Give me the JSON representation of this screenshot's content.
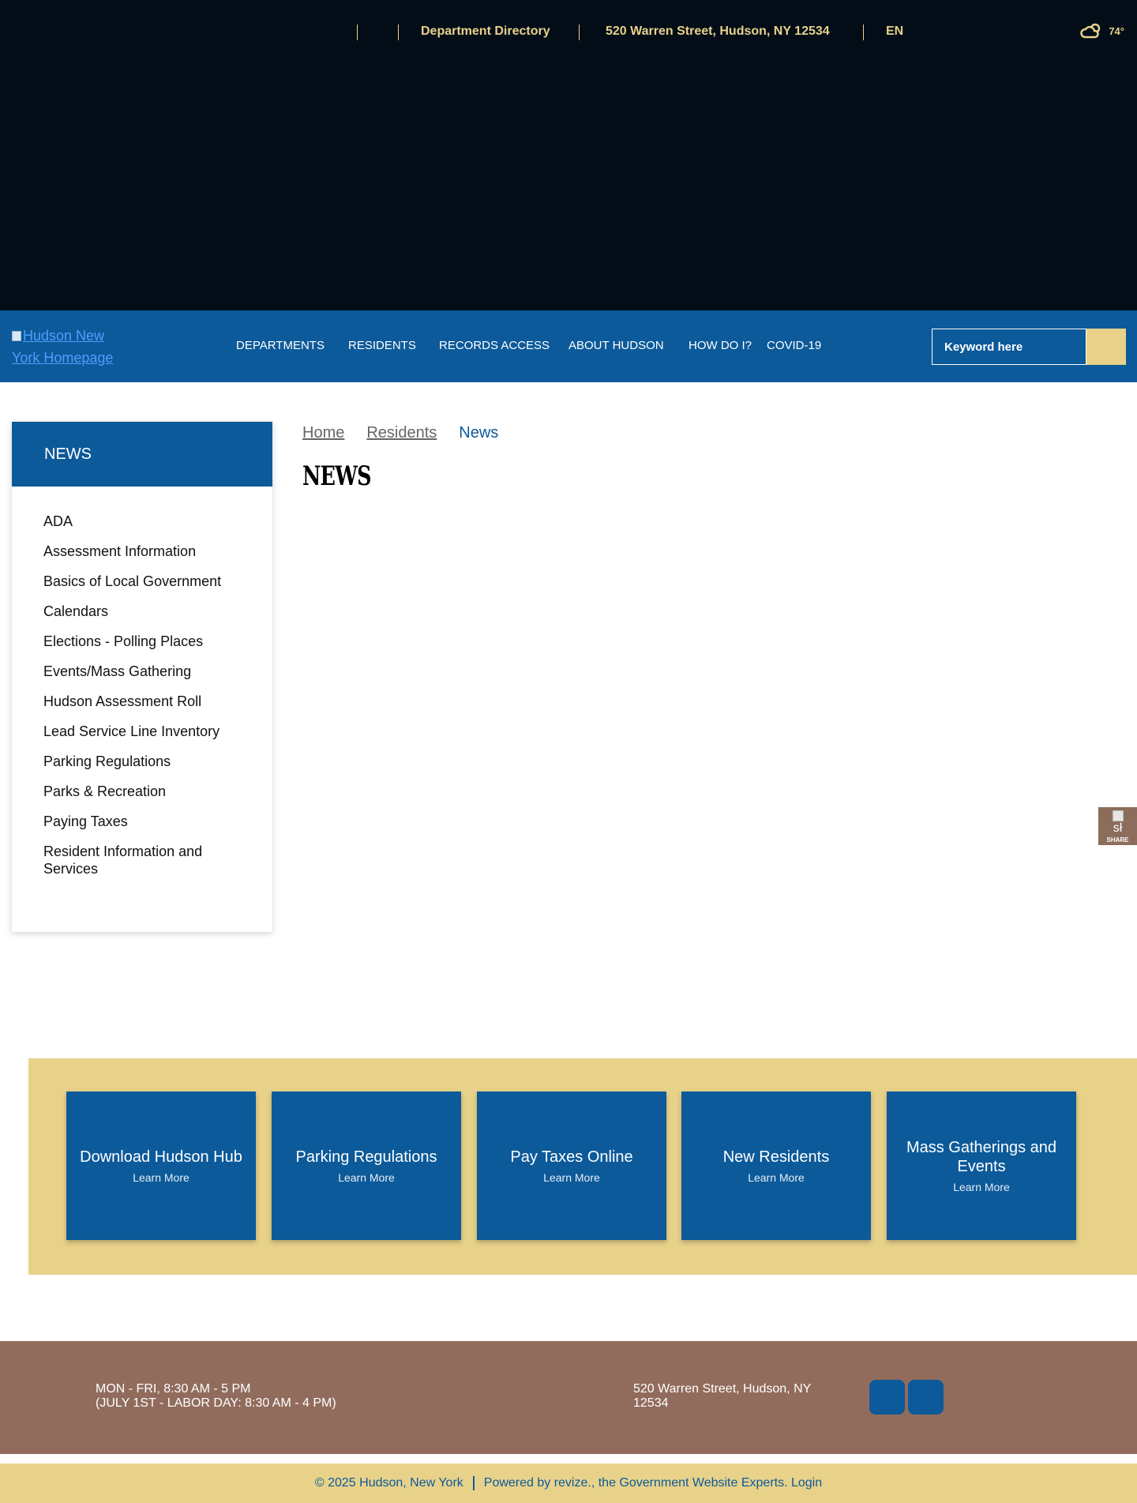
{
  "topbar": {
    "department_directory": "Department Directory",
    "address": "520 Warren Street, Hudson, NY 12534",
    "language": "EN",
    "temperature": "74°",
    "weather_icon": "cloud-sun-icon"
  },
  "header": {
    "logo_alt": "Hudson New York Homepage",
    "nav": [
      "DEPARTMENTS",
      "RESIDENTS",
      "RECORDS ACCESS",
      "ABOUT HUDSON",
      "HOW DO I?",
      "COVID-19"
    ],
    "search_placeholder": "Keyword here"
  },
  "sidebar": {
    "title": "NEWS",
    "items": [
      "ADA",
      "Assessment Information",
      "Basics of Local Government",
      "Calendars",
      "Elections - Polling Places",
      "Events/Mass Gathering",
      "Hudson Assessment Roll",
      "Lead Service Line Inventory",
      "Parking Regulations",
      "Parks & Recreation",
      "Paying Taxes",
      "Resident Information and Services"
    ]
  },
  "breadcrumb": [
    "Home",
    "Residents",
    "News"
  ],
  "page_title": "NEWS",
  "share": {
    "icon_text": "sł",
    "label": "SHARE"
  },
  "quick_links": [
    {
      "title": "Download Hudson Hub",
      "more": "Learn More"
    },
    {
      "title": "Parking Regulations",
      "more": "Learn More"
    },
    {
      "title": "Pay Taxes Online",
      "more": "Learn More"
    },
    {
      "title": "New Residents",
      "more": "Learn More"
    },
    {
      "title": "Mass Gatherings and Events",
      "more": "Learn More"
    }
  ],
  "footer": {
    "hours_line1": "MON - FRI, 8:30 AM - 5 PM",
    "hours_line2": "(JULY 1ST - LABOR DAY: 8:30 AM - 4 PM)",
    "address": "520 Warren Street, Hudson, NY 12534",
    "social": [
      "social-icon-1",
      "social-icon-2"
    ]
  },
  "copyright": {
    "left": "© 2025 Hudson, New York",
    "right": "Powered by revize., the Government Website Experts. Login"
  },
  "colors": {
    "primary": "#0c5a9a",
    "gold": "#e8d28a",
    "dark": "#020d18",
    "brown": "#916c5c"
  }
}
